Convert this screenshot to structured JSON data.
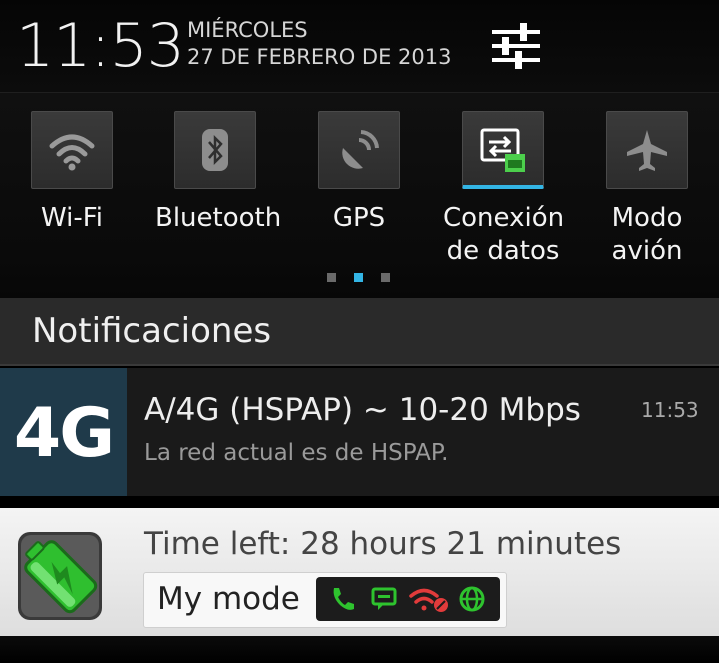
{
  "status": {
    "time": "11:53",
    "weekday": "MIÉRCOLES",
    "date": "27 DE FEBRERO DE 2013",
    "settings_icon": "sliders-icon"
  },
  "toggles": [
    {
      "label": "Wi-Fi",
      "icon": "wifi-icon",
      "active": false
    },
    {
      "label": "Bluetooth",
      "icon": "bluetooth-icon",
      "active": false
    },
    {
      "label": "GPS",
      "icon": "gps-icon",
      "active": false
    },
    {
      "label": "Conexión\nde datos",
      "icon": "data-connection-icon",
      "active": true
    },
    {
      "label": "Modo\navión",
      "icon": "airplane-icon",
      "active": false
    }
  ],
  "pager": {
    "page": 2,
    "pages": 3
  },
  "notifications_header": "Notificaciones",
  "network_notification": {
    "icon_text": "4G",
    "title": "A/4G (HSPAP) ~ 10-20 Mbps",
    "time": "11:53",
    "text": "La red actual es de HSPAP."
  },
  "battery_notification": {
    "time_left": "Time left: 28 hours 21 minutes",
    "mode_label": "My mode",
    "mode_icons": [
      "phone-icon",
      "message-icon",
      "wifi-off-icon",
      "globe-icon"
    ]
  },
  "colors": {
    "accent": "#33b5e5",
    "mode_green": "#2ec32e",
    "mode_red": "#e23b3b"
  }
}
